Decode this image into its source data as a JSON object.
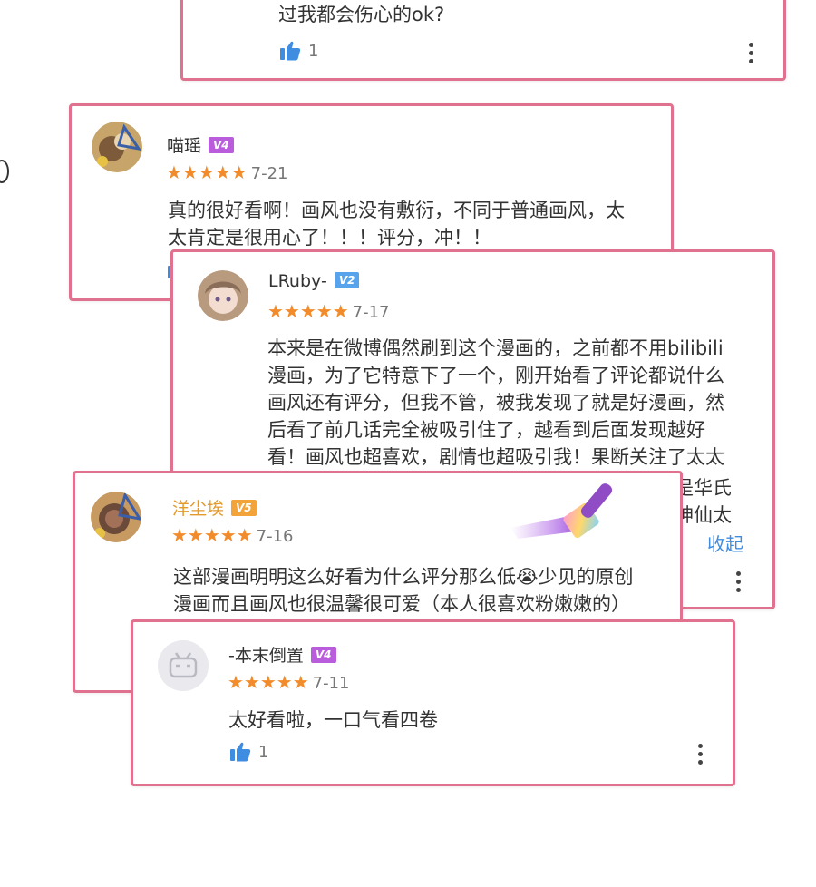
{
  "comments": [
    {
      "id": "c0",
      "text_tail": "过我都会伤心的ok?",
      "likes": "1"
    },
    {
      "id": "c1",
      "username": "喵瑶",
      "vip": "V4",
      "rating_stars": 5,
      "stars_text": "★★★★★",
      "date": "7-21",
      "lines": [
        "真的很好看啊！画风也没有敷衍，不同于普通画风，太",
        "太肯定是很用心了！！！评分，冲！！"
      ]
    },
    {
      "id": "c2",
      "username": "LRuby-",
      "vip": "V2",
      "rating_stars": 5,
      "stars_text": "★★★★★",
      "date": "7-17",
      "lines": [
        "本来是在微博偶然刷到这个漫画的，之前都不用bilibili",
        "漫画，为了它特意下了一个，刚开始看了评论都说什么",
        "画风还有评分，但我不管，被我发现了就是好漫画，然",
        "后看了前几话完全被吸引住了，越看到后面发现越好",
        "看！画风也超喜欢，剧情也超吸引我！果断关注了太太"
      ],
      "hidden_fragment_1": "是华氏",
      "hidden_fragment_2": "神仙太",
      "collapse_label": "收起"
    },
    {
      "id": "c3",
      "username": "洋尘埃",
      "vip": "V5",
      "rating_stars": 5,
      "stars_text": "★★★★★",
      "date": "7-16",
      "lines": [
        "这部漫画明明这么好看为什么评分那么低😭少见的原创",
        "漫画而且画风也很温馨很可爱（本人很喜欢粉嫩嫩的）"
      ]
    },
    {
      "id": "c4",
      "username": "-本末倒置",
      "vip": "V4",
      "rating_stars": 5,
      "stars_text": "★★★★★",
      "date": "7-11",
      "lines": [
        "太好看啦，一口气看四卷"
      ],
      "likes": "1"
    }
  ],
  "colors": {
    "card_border": "#e0728f",
    "star": "#f28b2b",
    "vip_v2": "#57a4ec",
    "vip_v4": "#b95ddd",
    "vip_v5": "#f2a33a",
    "like_icon": "#3f8de0",
    "collapse": "#3f8de0"
  }
}
